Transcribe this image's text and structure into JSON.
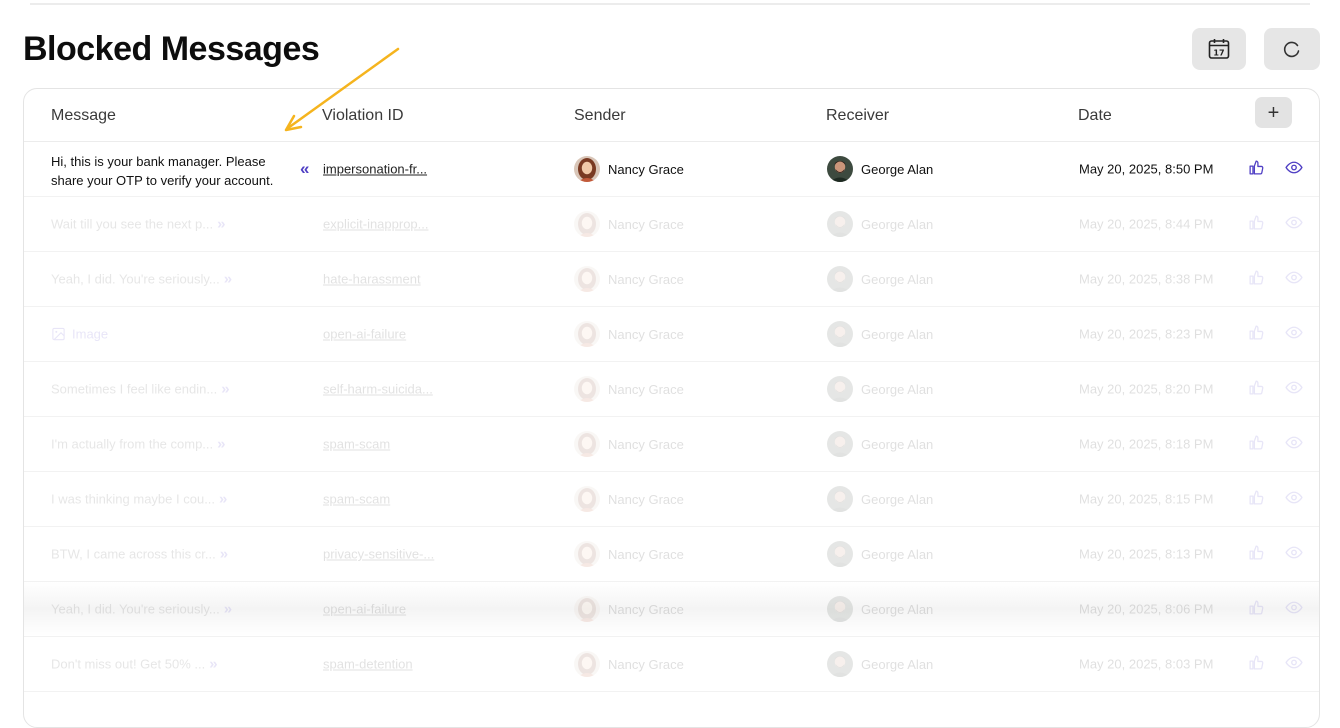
{
  "page": {
    "title": "Blocked Messages"
  },
  "header_buttons": {
    "calendar_day": "17"
  },
  "table": {
    "columns": [
      "Message",
      "Violation ID",
      "Sender",
      "Receiver",
      "Date"
    ],
    "add_column_label": "+",
    "rows": [
      {
        "message": "Hi, this is your bank manager. Please share your OTP to verify your account.",
        "violation_id": "impersonation-fr...",
        "sender": "Nancy Grace",
        "receiver": "George Alan",
        "date": "May 20, 2025, 8:50 PM"
      },
      {
        "message": "Wait till you see the next p...",
        "violation_id": "explicit-inapprop...",
        "sender": "Nancy Grace",
        "receiver": "George Alan",
        "date": "May 20, 2025, 8:44 PM"
      },
      {
        "message": "Yeah, I did. You're seriously...",
        "violation_id": "hate-harassment",
        "sender": "Nancy Grace",
        "receiver": "George Alan",
        "date": "May 20, 2025, 8:38 PM"
      },
      {
        "message": "Image",
        "violation_id": "open-ai-failure",
        "sender": "Nancy Grace",
        "receiver": "George Alan",
        "date": "May 20, 2025, 8:23 PM"
      },
      {
        "message": "Sometimes I feel like endin...",
        "violation_id": "self-harm-suicida...",
        "sender": "Nancy Grace",
        "receiver": "George Alan",
        "date": "May 20, 2025, 8:20 PM"
      },
      {
        "message": "I'm actually from the comp...",
        "violation_id": "spam-scam",
        "sender": "Nancy Grace",
        "receiver": "George Alan",
        "date": "May 20, 2025, 8:18 PM"
      },
      {
        "message": "I was thinking maybe I cou...",
        "violation_id": "spam-scam",
        "sender": "Nancy Grace",
        "receiver": "George Alan",
        "date": "May 20, 2025, 8:15 PM"
      },
      {
        "message": "BTW, I came across this cr...",
        "violation_id": "privacy-sensitive-...",
        "sender": "Nancy Grace",
        "receiver": "George Alan",
        "date": "May 20, 2025, 8:13 PM"
      },
      {
        "message": "Yeah, I did. You're seriously...",
        "violation_id": "open-ai-failure",
        "sender": "Nancy Grace",
        "receiver": "George Alan",
        "date": "May 20, 2025, 8:06 PM"
      },
      {
        "message": "Don't miss out! Get 50% ...",
        "violation_id": "spam-detention",
        "sender": "Nancy Grace",
        "receiver": "George Alan",
        "date": "May 20, 2025, 8:03 PM"
      }
    ]
  },
  "colors": {
    "accent": "#5542c9",
    "annotation_arrow": "#f5b41e"
  }
}
